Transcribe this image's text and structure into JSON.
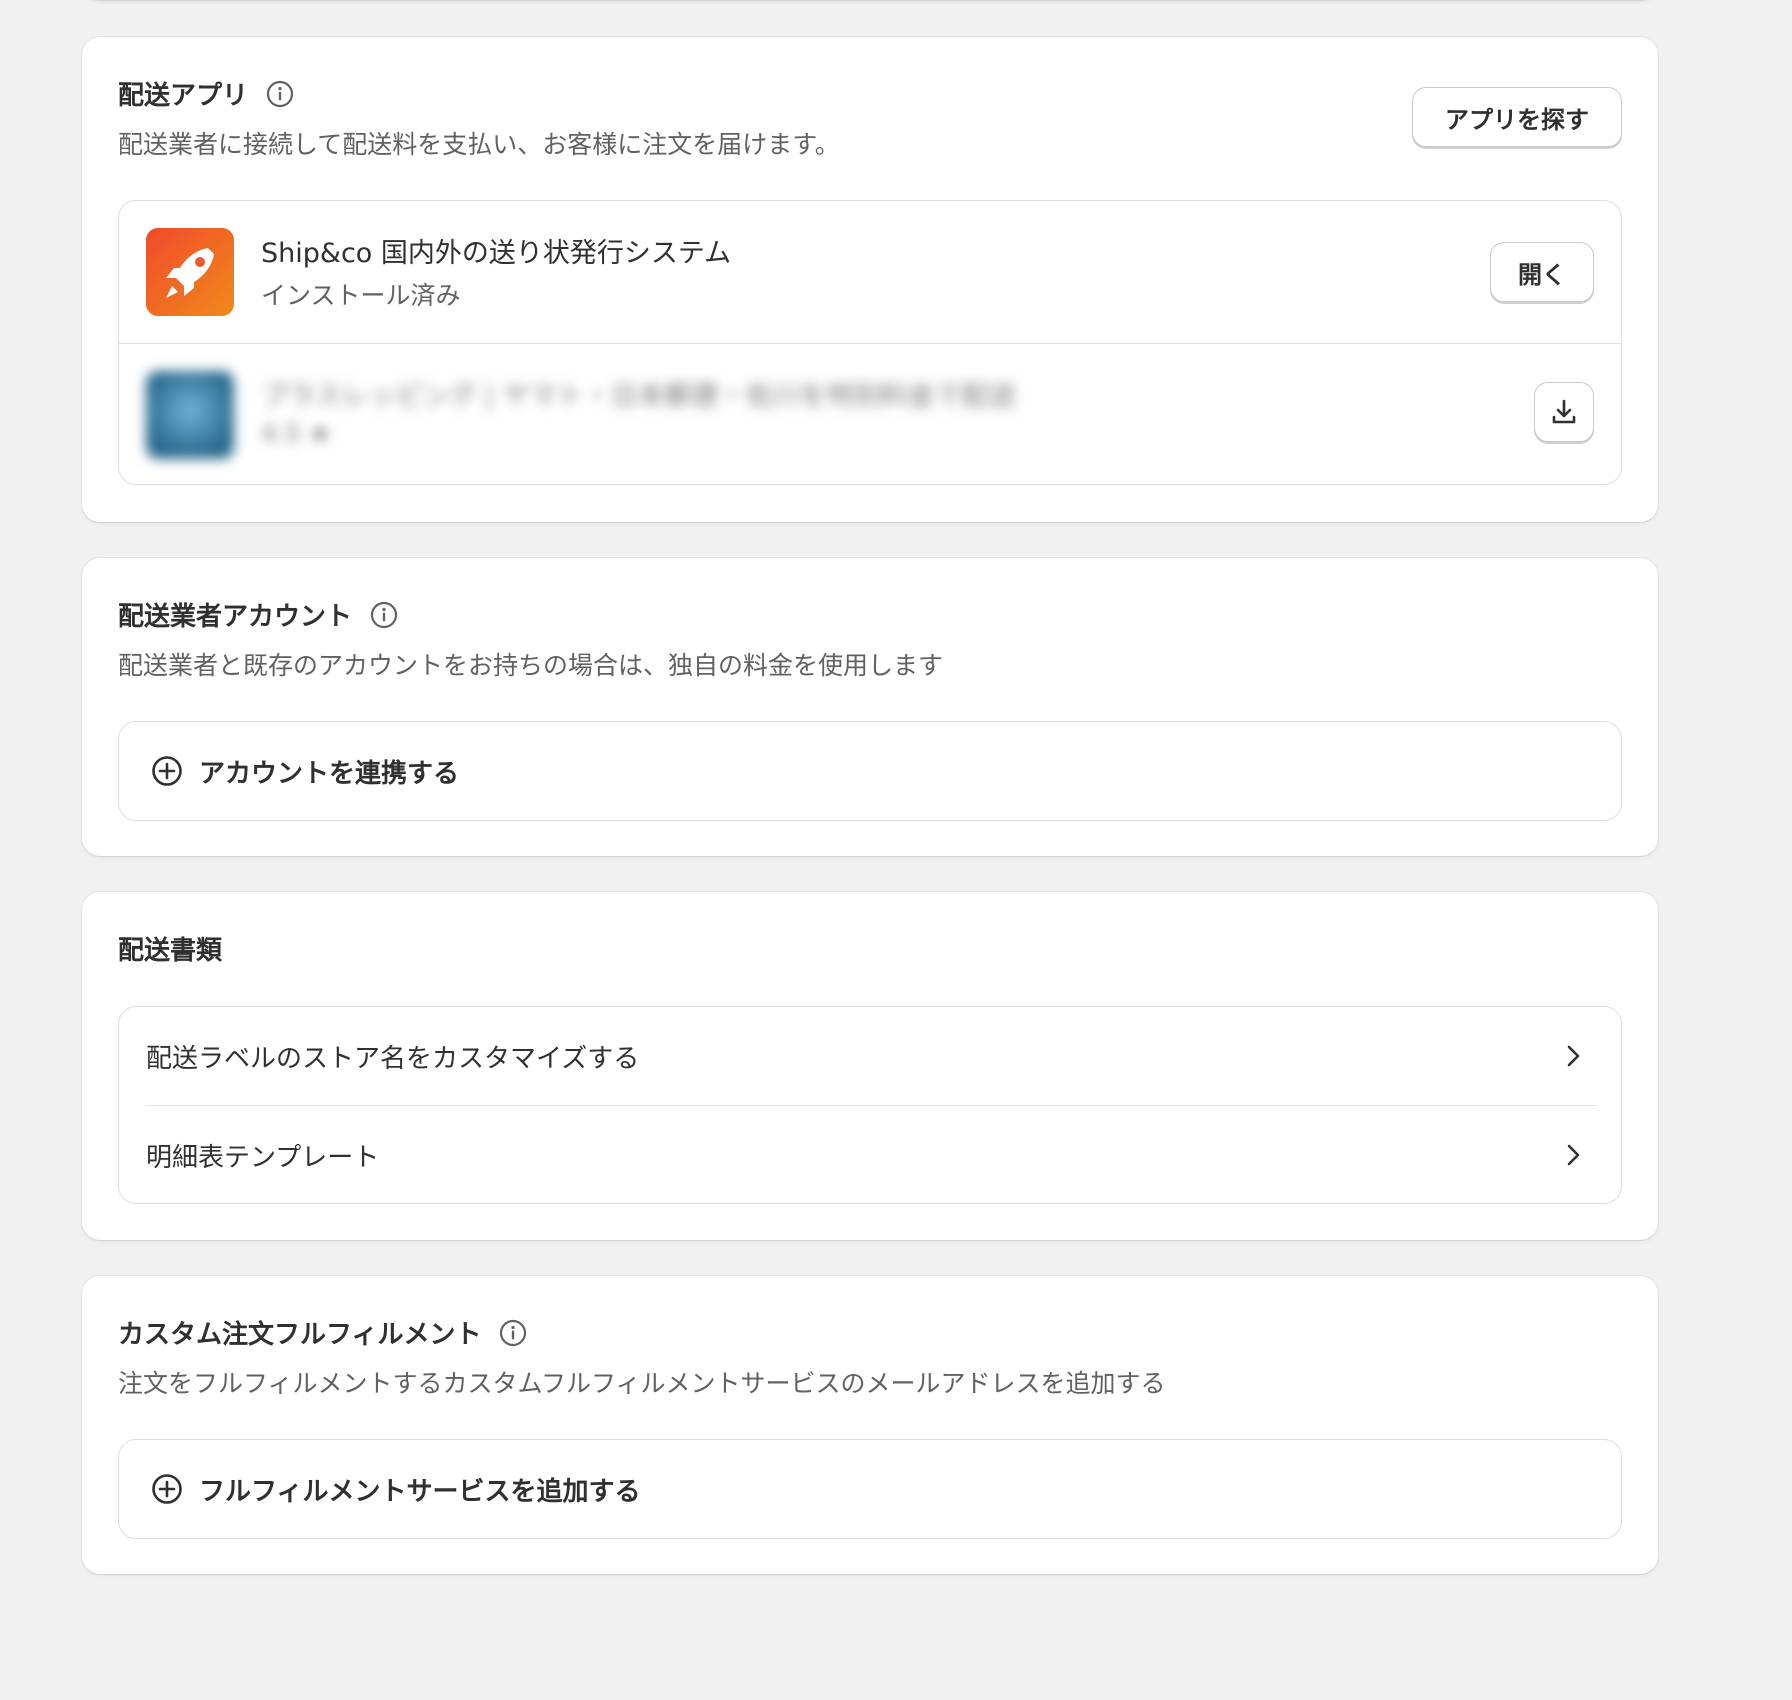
{
  "shipping_apps": {
    "title": "配送アプリ",
    "subtitle": "配送業者に接続して配送料を支払い、お客様に注文を届けます。",
    "find_apps_button": "アプリを探す",
    "apps": [
      {
        "name": "Ship&co 国内外の送り状発行システム",
        "status": "インストール済み",
        "action_label": "開く",
        "icon": "rocket-icon",
        "icon_colors": [
          "#f0522a",
          "#f07a1c"
        ]
      },
      {
        "name": "プラスレッピング | ヤマト・日本郵便・佐川を特別料金で配送",
        "status": "4.5 ★",
        "action_label": "",
        "icon": "download-icon",
        "icon_colors": [
          "#2e6f93",
          "#5ba0c4"
        ]
      }
    ]
  },
  "carrier_accounts": {
    "title": "配送業者アカウント",
    "subtitle": "配送業者と既存のアカウントをお持ちの場合は、独自の料金を使用します",
    "add_label": "アカウントを連携する"
  },
  "shipping_documents": {
    "title": "配送書類",
    "items": [
      {
        "label": "配送ラベルのストア名をカスタマイズする"
      },
      {
        "label": "明細表テンプレート"
      }
    ]
  },
  "custom_fulfillment": {
    "title": "カスタム注文フルフィルメント",
    "subtitle": "注文をフルフィルメントするカスタムフルフィルメントサービスのメールアドレスを追加する",
    "add_label": "フルフィルメントサービスを追加する"
  }
}
